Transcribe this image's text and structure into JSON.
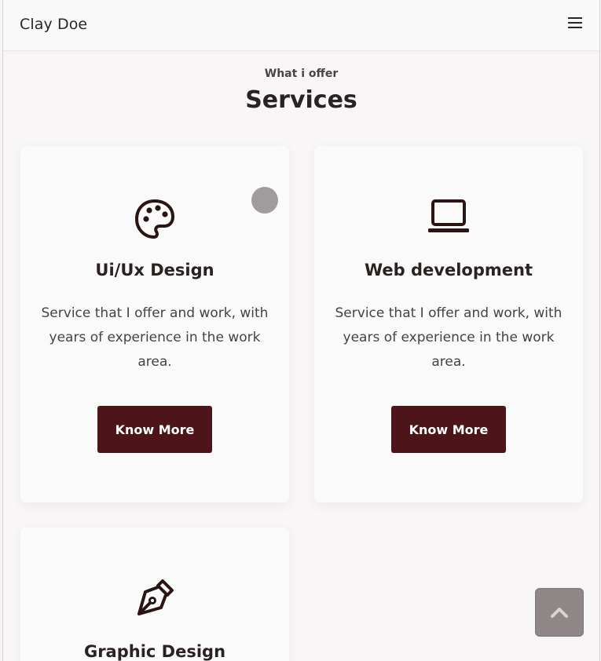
{
  "navbar": {
    "brand": "Clay Doe",
    "menu_icon": "hamburger-menu-icon"
  },
  "services": {
    "subtitle": "What i offer",
    "title": "Services",
    "cards": [
      {
        "icon": "palette-icon",
        "title": "Ui/Ux Design",
        "description": "Service that I offer and work, with years of experience in the work area.",
        "button": "Know More"
      },
      {
        "icon": "laptop-icon",
        "title": "Web development",
        "description": "Service that I offer and work, with years of experience in the work area.",
        "button": "Know More"
      },
      {
        "icon": "pen-nib-icon",
        "title": "Graphic Design"
      }
    ]
  },
  "scroll_top": {
    "icon": "chevron-up-icon"
  },
  "colors": {
    "accent": "#4d1519",
    "background": "#f8f6f6",
    "text": "#2a2121"
  }
}
